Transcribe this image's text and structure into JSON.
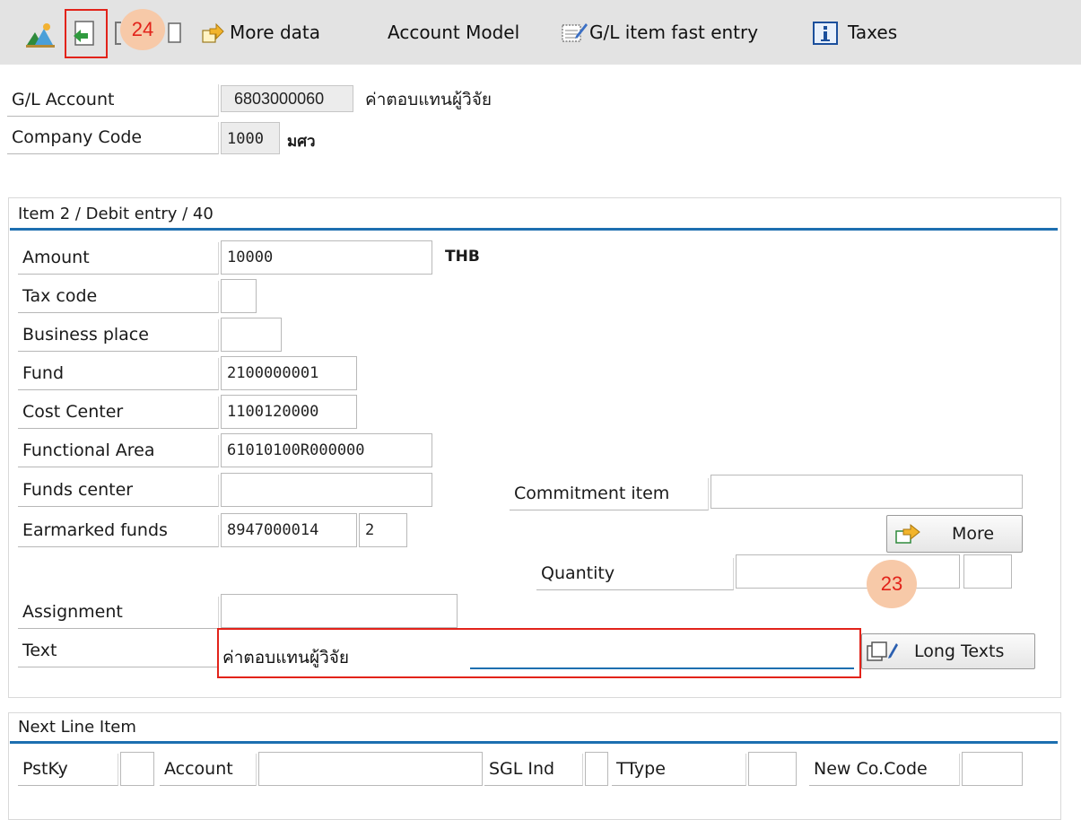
{
  "toolbar": {
    "more_data": "More data",
    "account_model": "Account Model",
    "gl_fast_entry": "G/L item fast entry",
    "taxes": "Taxes"
  },
  "header": {
    "gl_account_label": "G/L Account",
    "gl_account_value": "6803000060",
    "gl_account_desc": "ค่าตอบแทนผู้วิจัย",
    "company_code_label": "Company Code",
    "company_code_value": "1000",
    "company_code_desc": "มศว"
  },
  "item": {
    "title": "Item 2 / Debit entry / 40",
    "amount_label": "Amount",
    "amount_value": "10000",
    "currency": "THB",
    "tax_code_label": "Tax code",
    "tax_code_value": "",
    "business_place_label": "Business place",
    "business_place_value": "",
    "fund_label": "Fund",
    "fund_value": "2100000001",
    "cost_center_label": "Cost Center",
    "cost_center_value": "1100120000",
    "functional_area_label": "Functional Area",
    "functional_area_value": "61010100R000000",
    "funds_center_label": "Funds center",
    "funds_center_value": "",
    "commitment_item_label": "Commitment item",
    "commitment_item_value": "",
    "earmarked_label": "Earmarked funds",
    "earmarked_value": "8947000014",
    "earmarked_item": "2",
    "more_button": "More",
    "quantity_label": "Quantity",
    "quantity_value": "",
    "quantity_unit": "",
    "assignment_label": "Assignment",
    "assignment_value": "",
    "text_label": "Text",
    "text_value": "ค่าตอบแทนผู้วิจัย",
    "long_texts_button": "Long Texts"
  },
  "next_line": {
    "title": "Next Line Item",
    "pstky_label": "PstKy",
    "pstky_value": "",
    "account_label": "Account",
    "account_value": "",
    "sgl_label": "SGL Ind",
    "sgl_value": "",
    "ttype_label": "TType",
    "ttype_value": "",
    "new_cocode_label": "New Co.Code",
    "new_cocode_value": ""
  },
  "callouts": {
    "c24": "24",
    "c23": "23"
  },
  "colors": {
    "accent_rule": "#1d6fb0",
    "callout_fill": "#f7c9a8",
    "callout_text": "#e2231a",
    "highlight_box": "#e2231a",
    "toolbar_bg": "#e3e3e3"
  }
}
